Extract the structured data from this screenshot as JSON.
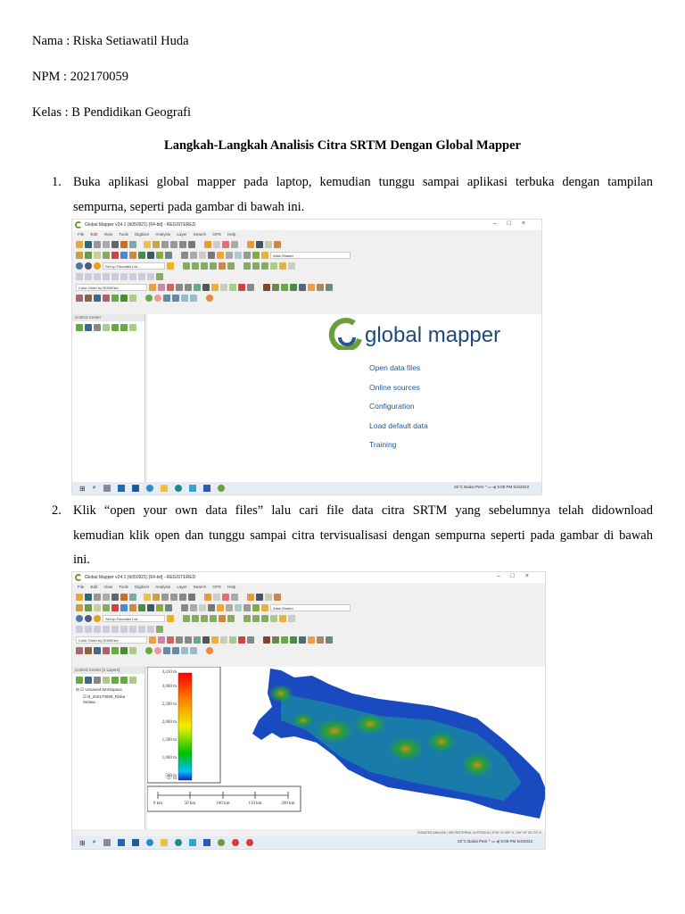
{
  "header": {
    "name": "Nama : Riska Setiawatil Huda",
    "npm": "NPM : 202170059",
    "kelas": "Kelas : B Pendidikan Geografi"
  },
  "doc_title": "Langkah-Langkah Analisis Citra SRTM Dengan Global Mapper",
  "steps": [
    {
      "num": "1.",
      "line1": "Buka aplikasi global mapper pada laptop, kemudian tunggu sampai aplikasi terbuka dengan tampilan",
      "line2": "sempurna, seperti pada gambar di bawah ini."
    },
    {
      "num": "2.",
      "line1": "Klik “open your own data files” lalu cari file data citra SRTM yang sebelumnya telah didownload",
      "line2": "kemudian klik open dan tunggu sampai citra tervisualisasi dengan sempurna seperti pada gambar di bawah",
      "line3": "ini."
    }
  ],
  "app": {
    "title": "Global Mapper v24.1 (b050921) [64-bit] - REGISTERED",
    "menu": "File Edit View Tools Digitizer Analysis Layer Search GPS Help",
    "shader": "Atlas Shader",
    "favorites": "Set up Favorites List ...",
    "color_order": "Color Order by RGB/Elev",
    "control_center": "Control Center",
    "control_center_layers": "Control Center [1 Layers]",
    "workspace": "Unsaved Workspace",
    "layer": "B_202170059_Riska Setiaw...",
    "brand": "global mapper",
    "start_links": [
      "Open data files",
      "Online sources",
      "Configuration",
      "Load default data",
      "Training"
    ],
    "tray": {
      "weather": "25°C  Badai Petir",
      "time": "5:08 PM",
      "date": "5/4/2023"
    },
    "legend": {
      "labels": [
        "3,410 m",
        "3,000 m",
        "2,500 m",
        "2,000 m",
        "1,500 m",
        "1,000 m",
        "500 m",
        "-27 m"
      ]
    },
    "scale": {
      "labels": [
        "0 km",
        "50 km",
        "100 km",
        "150 km",
        "200 km"
      ]
    },
    "status": "GOBATED ANALISA | ISB PASTERNA, AUSTRALIA | 6°26' 21.000\" S, 106° 00' 08.776\" E"
  }
}
